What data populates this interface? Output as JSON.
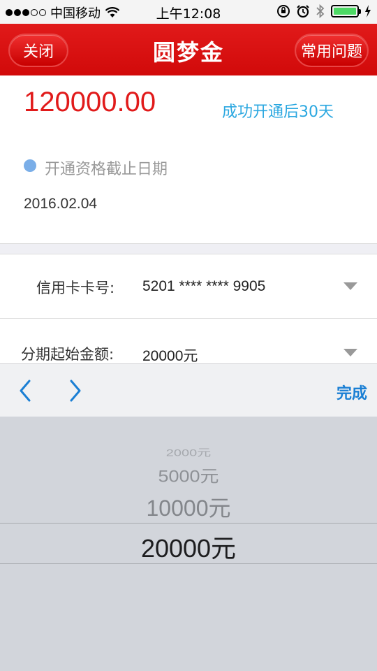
{
  "status_bar": {
    "carrier": "中国移动",
    "time": "上午12:08",
    "battery_level": 1.0,
    "signal_bars": 3,
    "battery_color": "#4cd964"
  },
  "nav": {
    "close_label": "关闭",
    "title": "圆梦金",
    "faq_label": "常用问题",
    "bar_color": "#d10a0a"
  },
  "summary": {
    "amount": "120000.00",
    "amount_color": "#e11a1a",
    "success_note": "成功开通后30天",
    "note_color": "#2aa7e0",
    "deadline_label": "开通资格截止日期",
    "deadline_date": "2016.02.04"
  },
  "form": {
    "card_label": "信用卡卡号:",
    "card_value": "5201 **** **** 9905",
    "start_amount_label": "分期起始金额:",
    "start_amount_value": "20000元"
  },
  "toolbar": {
    "prev_icon": "chevron-left-icon",
    "next_icon": "chevron-right-icon",
    "done_label": "完成",
    "accent": "#1a7fd4"
  },
  "picker": {
    "options": [
      "2000元",
      "5000元",
      "10000元",
      "20000元"
    ],
    "selected": "20000元"
  }
}
